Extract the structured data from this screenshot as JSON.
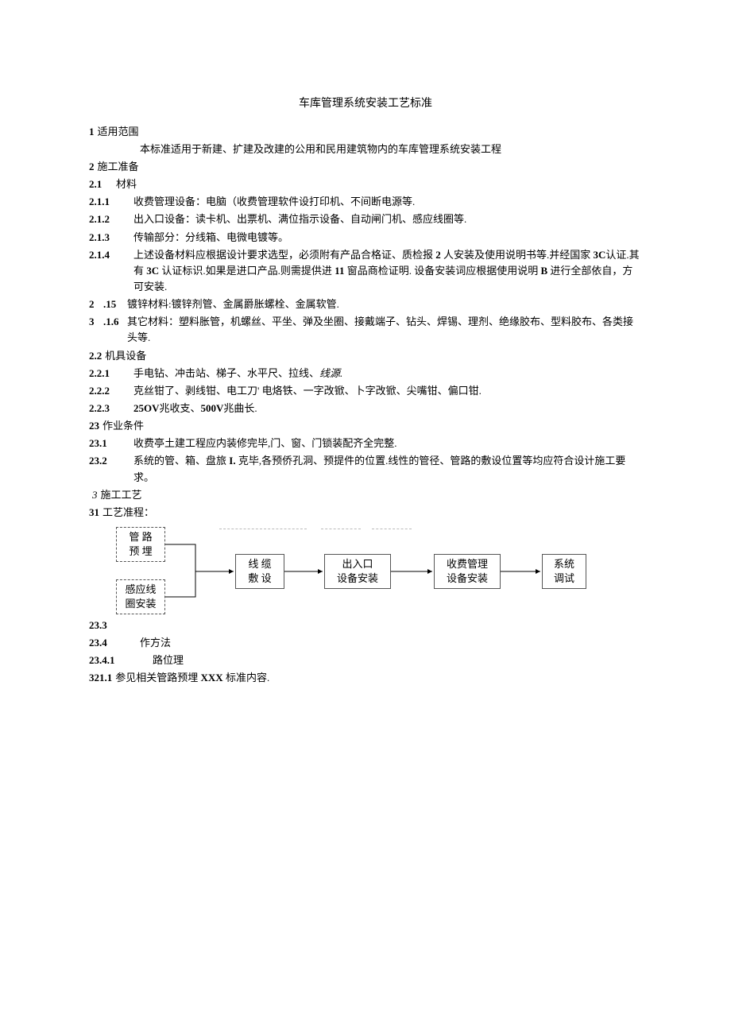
{
  "title": "车库管理系统安装工艺标准",
  "s1": {
    "num": "1",
    "heading": "适用范围",
    "body": "本标准适用于新建、扩建及改建的公用和民用建筑物内的车库管理系统安装工程"
  },
  "s2": {
    "num": "2",
    "heading": "施工准备",
    "s2_1": {
      "num": "2.1",
      "text": "材料"
    },
    "s2_1_1": {
      "num": "2.1.1",
      "text": "收费管理设备：电脑（收费管理软件设打印机、不间断电源等."
    },
    "s2_1_2": {
      "num": "2.1.2",
      "text": "出入口设备：读卡机、出票机、满位指示设备、自动闸门机、感应线圈等."
    },
    "s2_1_3": {
      "num": "2.1.3",
      "text": "传输部分：分线箱、电微电镀等。"
    },
    "s2_1_4": {
      "num": "2.1.4",
      "text": "上述设备材料应根据设计要求选型，必须附有产品合格证、质检报 ",
      "bold_a": "2",
      "text_b": " 人安装及使用说明书等.并经国家 ",
      "bold_b": "3C",
      "text_c": "认证.其有 ",
      "bold_c": "3C",
      "text_d": " 认证标识.如果是进口产品.则需提供进 ",
      "bold_d": "11",
      "text_e": " 窗品商检证明. 设备安装词应根据使用说明 ",
      "bold_e": "B",
      "text_f": " 进行全部依自，方可安装."
    },
    "s2_1_5_pre": "2",
    "s2_1_5_num": ".15",
    "s2_1_5_text": "镀锌材料:镀锌剂管、金属爵胀螺栓、金属软管.",
    "s2_1_6_pre": "3",
    "s2_1_6_num": ".1.6",
    "s2_1_6_text": "其它材料：塑料胀管，机螺丝、平坐、弹及坐圈、接戴端子、钻头、焊锡、理剂、绝缘胶布、型料胶布、各类接头等.",
    "s2_2": {
      "num": "2.2",
      "text": "机具设备"
    },
    "s2_2_1": {
      "num": "2.2.1",
      "text_a": "手电钻、冲击站、梯子、水平尺、拉线、",
      "italic": "线源."
    },
    "s2_2_2": {
      "num": "2.2.2",
      "text": "克丝钳了、剥线钳、电工刀' 电烙铁、一字改锨、卜字改锨、尖嘴钳、偏口钳."
    },
    "s2_2_3": {
      "num": "2.2.3",
      "bold_a": "25OV",
      "mid": "兆收支、",
      "bold_b": "500V",
      "tail": "兆曲长."
    },
    "s2_3": {
      "num": "23",
      "text": "作业条件"
    },
    "s2_3_1": {
      "num": "23.1",
      "text": "收费亭土建工程应内装修完毕,门、窗、门锁装配齐全完整."
    },
    "s2_3_2": {
      "num": "23.2",
      "text_a": "系统的管、箱、盘旅 ",
      "bold": "I.",
      "text_b": " 克毕,各预侨孔洞、预提件的位置.线性的管径、管路的敷设位置等均应符合设计施工要求。"
    }
  },
  "s3": {
    "num_italic": "3",
    "heading": "施工工艺",
    "s3_1": {
      "num": "31",
      "text": "工艺准程："
    },
    "flow": {
      "b1": "管 路\n预 埋",
      "b2": "感应线\n圈安装",
      "b3": "线 缆\n敷 设",
      "b4": "出入口\n设备安装",
      "b5": "收费管理\n设备安装",
      "b6": "系统\n调试"
    },
    "s23_3": {
      "num": "23.3"
    },
    "s23_4": {
      "num": "23.4",
      "text": "作方法"
    },
    "s23_4_1": {
      "num": "23.4.1",
      "text": "路位理"
    },
    "s321_1": {
      "num": "321.1",
      "text_a": "参见相关管路预埋 ",
      "bold": "XXX",
      "text_b": " 标准内容."
    }
  }
}
